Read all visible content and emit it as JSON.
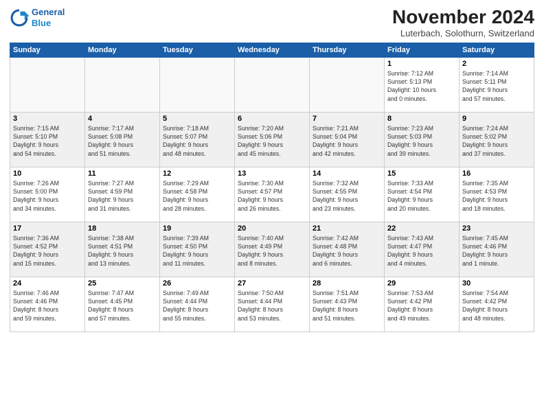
{
  "header": {
    "logo_line1": "General",
    "logo_line2": "Blue",
    "title": "November 2024",
    "subtitle": "Luterbach, Solothurn, Switzerland"
  },
  "columns": [
    "Sunday",
    "Monday",
    "Tuesday",
    "Wednesday",
    "Thursday",
    "Friday",
    "Saturday"
  ],
  "weeks": [
    {
      "days": [
        {
          "num": "",
          "detail": ""
        },
        {
          "num": "",
          "detail": ""
        },
        {
          "num": "",
          "detail": ""
        },
        {
          "num": "",
          "detail": ""
        },
        {
          "num": "",
          "detail": ""
        },
        {
          "num": "1",
          "detail": "Sunrise: 7:12 AM\nSunset: 5:13 PM\nDaylight: 10 hours\nand 0 minutes."
        },
        {
          "num": "2",
          "detail": "Sunrise: 7:14 AM\nSunset: 5:11 PM\nDaylight: 9 hours\nand 57 minutes."
        }
      ]
    },
    {
      "days": [
        {
          "num": "3",
          "detail": "Sunrise: 7:15 AM\nSunset: 5:10 PM\nDaylight: 9 hours\nand 54 minutes."
        },
        {
          "num": "4",
          "detail": "Sunrise: 7:17 AM\nSunset: 5:08 PM\nDaylight: 9 hours\nand 51 minutes."
        },
        {
          "num": "5",
          "detail": "Sunrise: 7:18 AM\nSunset: 5:07 PM\nDaylight: 9 hours\nand 48 minutes."
        },
        {
          "num": "6",
          "detail": "Sunrise: 7:20 AM\nSunset: 5:06 PM\nDaylight: 9 hours\nand 45 minutes."
        },
        {
          "num": "7",
          "detail": "Sunrise: 7:21 AM\nSunset: 5:04 PM\nDaylight: 9 hours\nand 42 minutes."
        },
        {
          "num": "8",
          "detail": "Sunrise: 7:23 AM\nSunset: 5:03 PM\nDaylight: 9 hours\nand 39 minutes."
        },
        {
          "num": "9",
          "detail": "Sunrise: 7:24 AM\nSunset: 5:02 PM\nDaylight: 9 hours\nand 37 minutes."
        }
      ]
    },
    {
      "days": [
        {
          "num": "10",
          "detail": "Sunrise: 7:26 AM\nSunset: 5:00 PM\nDaylight: 9 hours\nand 34 minutes."
        },
        {
          "num": "11",
          "detail": "Sunrise: 7:27 AM\nSunset: 4:59 PM\nDaylight: 9 hours\nand 31 minutes."
        },
        {
          "num": "12",
          "detail": "Sunrise: 7:29 AM\nSunset: 4:58 PM\nDaylight: 9 hours\nand 28 minutes."
        },
        {
          "num": "13",
          "detail": "Sunrise: 7:30 AM\nSunset: 4:57 PM\nDaylight: 9 hours\nand 26 minutes."
        },
        {
          "num": "14",
          "detail": "Sunrise: 7:32 AM\nSunset: 4:55 PM\nDaylight: 9 hours\nand 23 minutes."
        },
        {
          "num": "15",
          "detail": "Sunrise: 7:33 AM\nSunset: 4:54 PM\nDaylight: 9 hours\nand 20 minutes."
        },
        {
          "num": "16",
          "detail": "Sunrise: 7:35 AM\nSunset: 4:53 PM\nDaylight: 9 hours\nand 18 minutes."
        }
      ]
    },
    {
      "days": [
        {
          "num": "17",
          "detail": "Sunrise: 7:36 AM\nSunset: 4:52 PM\nDaylight: 9 hours\nand 15 minutes."
        },
        {
          "num": "18",
          "detail": "Sunrise: 7:38 AM\nSunset: 4:51 PM\nDaylight: 9 hours\nand 13 minutes."
        },
        {
          "num": "19",
          "detail": "Sunrise: 7:39 AM\nSunset: 4:50 PM\nDaylight: 9 hours\nand 11 minutes."
        },
        {
          "num": "20",
          "detail": "Sunrise: 7:40 AM\nSunset: 4:49 PM\nDaylight: 9 hours\nand 8 minutes."
        },
        {
          "num": "21",
          "detail": "Sunrise: 7:42 AM\nSunset: 4:48 PM\nDaylight: 9 hours\nand 6 minutes."
        },
        {
          "num": "22",
          "detail": "Sunrise: 7:43 AM\nSunset: 4:47 PM\nDaylight: 9 hours\nand 4 minutes."
        },
        {
          "num": "23",
          "detail": "Sunrise: 7:45 AM\nSunset: 4:46 PM\nDaylight: 9 hours\nand 1 minute."
        }
      ]
    },
    {
      "days": [
        {
          "num": "24",
          "detail": "Sunrise: 7:46 AM\nSunset: 4:46 PM\nDaylight: 8 hours\nand 59 minutes."
        },
        {
          "num": "25",
          "detail": "Sunrise: 7:47 AM\nSunset: 4:45 PM\nDaylight: 8 hours\nand 57 minutes."
        },
        {
          "num": "26",
          "detail": "Sunrise: 7:49 AM\nSunset: 4:44 PM\nDaylight: 8 hours\nand 55 minutes."
        },
        {
          "num": "27",
          "detail": "Sunrise: 7:50 AM\nSunset: 4:44 PM\nDaylight: 8 hours\nand 53 minutes."
        },
        {
          "num": "28",
          "detail": "Sunrise: 7:51 AM\nSunset: 4:43 PM\nDaylight: 8 hours\nand 51 minutes."
        },
        {
          "num": "29",
          "detail": "Sunrise: 7:53 AM\nSunset: 4:42 PM\nDaylight: 8 hours\nand 49 minutes."
        },
        {
          "num": "30",
          "detail": "Sunrise: 7:54 AM\nSunset: 4:42 PM\nDaylight: 8 hours\nand 48 minutes."
        }
      ]
    }
  ]
}
